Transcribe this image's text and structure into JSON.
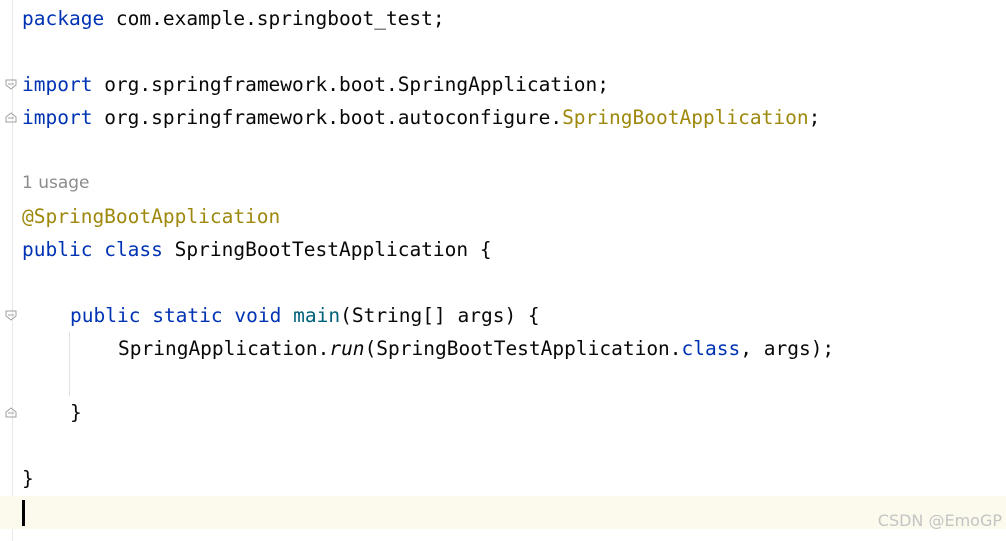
{
  "code": {
    "line1": {
      "kw": "package",
      "rest": " com.example.springboot_test;"
    },
    "line3": {
      "kw": "import",
      "rest": " org.springframework.boot.SpringApplication;"
    },
    "line4": {
      "kw": "import",
      "rest": " org.springframework.boot.autoconfigure.",
      "ann": "SpringBootApplication",
      "end": ";"
    },
    "usage_hint": "1 usage",
    "annotation": "@SpringBootApplication",
    "class_decl": {
      "kw1": "public",
      "kw2": "class",
      "rest": " SpringBootTestApplication {"
    },
    "main_decl": {
      "kw1": "public",
      "kw2": "static",
      "kw3": "void",
      "fn": "main",
      "rest": "(String[] args) {"
    },
    "body": {
      "a": "SpringApplication.",
      "run": "run",
      "b": "(SpringBootTestApplication.",
      "cls": "class",
      "c": ", args);"
    },
    "close_method": "}",
    "close_class": "}"
  },
  "watermark": "CSDN @EmoGP",
  "colors": {
    "keyword": "#0033b3",
    "annotation": "#9e880d",
    "method": "#00627a",
    "hint": "#8c8c8c",
    "caret_line": "#fcfaed"
  }
}
